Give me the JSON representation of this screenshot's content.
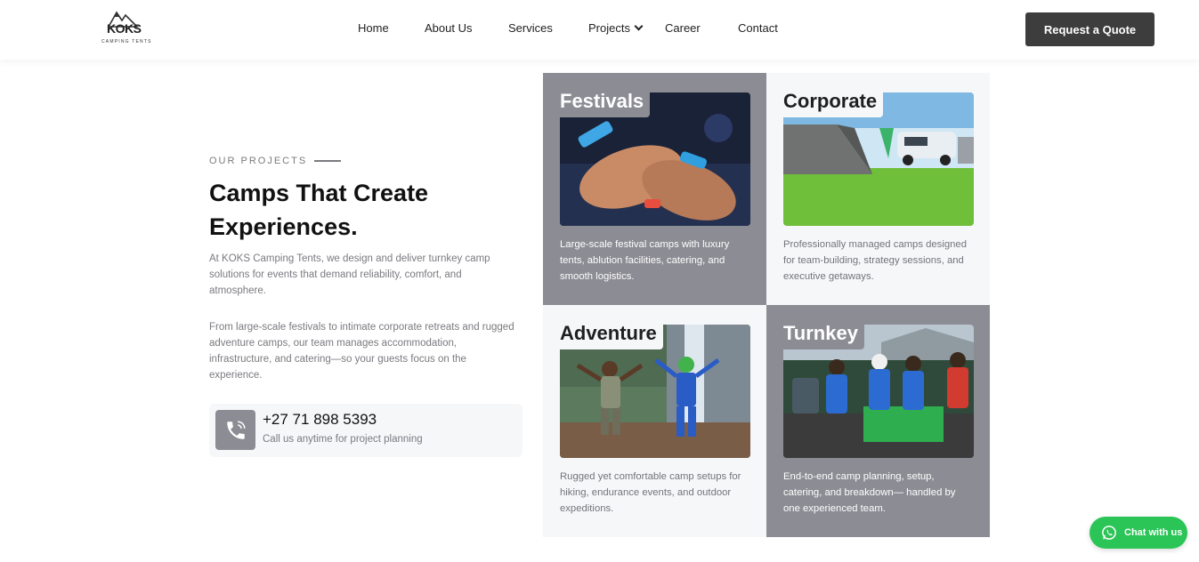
{
  "header": {
    "logo_text": "KOKS",
    "logo_sub": "CAMPING TENTS",
    "nav": [
      {
        "label": "Home"
      },
      {
        "label": "About Us"
      },
      {
        "label": "Services"
      },
      {
        "label": "Projects"
      },
      {
        "label": "Career"
      },
      {
        "label": "Contact"
      }
    ],
    "cta_label": "Request a Quote"
  },
  "intro": {
    "eyebrow": "OUR PROJECTS",
    "heading": "Camps That Create Experiences.",
    "para1": "At KOKS Camping Tents, we design and deliver turnkey camp solutions for events that demand reliability, comfort, and atmosphere.",
    "para2": "From large-scale festivals to intimate corporate retreats and rugged adventure camps, our team manages accommodation, infrastructure, and catering—so your guests focus on the experience.",
    "phone_number": "+27 71 898 5393",
    "phone_sub": "Call us anytime for project planning"
  },
  "projects": [
    {
      "title": "Festivals",
      "text": "Large-scale festival camps with luxury tents, ablution facilities, catering, and smooth logistics.",
      "icon": "festival-wristbands-photo"
    },
    {
      "title": "Corporate",
      "text": "Professionally managed camps designed for team-building, strategy sessions, and executive getaways.",
      "icon": "corporate-camp-photo"
    },
    {
      "title": "Adventure",
      "text": "Rugged yet comfortable camp setups for hiking, endurance events, and outdoor expeditions.",
      "icon": "adventure-hikers-photo"
    },
    {
      "title": "Turnkey",
      "text": "End-to-end camp planning, setup, catering, and breakdown— handled by one experienced team.",
      "icon": "turnkey-team-photo"
    }
  ],
  "whatsapp": {
    "label": "Chat with us"
  },
  "colors": {
    "dark_card": "#8c8c94",
    "light_card": "#f6f7f9",
    "cta": "#3d3d3d",
    "whatsapp": "#2bc457"
  }
}
